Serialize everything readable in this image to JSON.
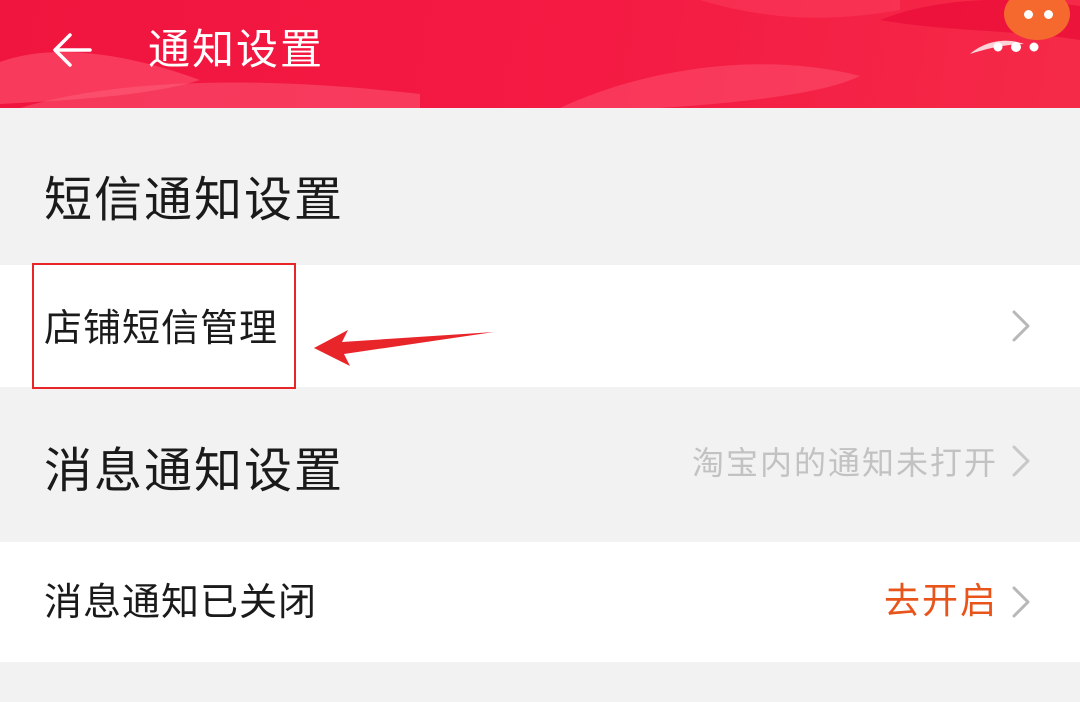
{
  "header": {
    "title": "通知设置",
    "background_color": "#f41a43",
    "back_icon": "arrow-left-icon",
    "more_icon": "more-dots-icon"
  },
  "sms_section": {
    "title": "短信通知设置",
    "items": [
      {
        "label": "店铺短信管理",
        "icon": "chevron-right-icon"
      }
    ]
  },
  "message_section": {
    "title": "消息通知设置",
    "hint": "淘宝内的通知未打开",
    "items": [
      {
        "label": "消息通知已关闭",
        "action": "去开启",
        "action_color": "#e8541a",
        "icon": "chevron-right-icon"
      }
    ]
  },
  "annotation": {
    "box_color": "#e8262a",
    "arrow_color": "#e8262a"
  }
}
